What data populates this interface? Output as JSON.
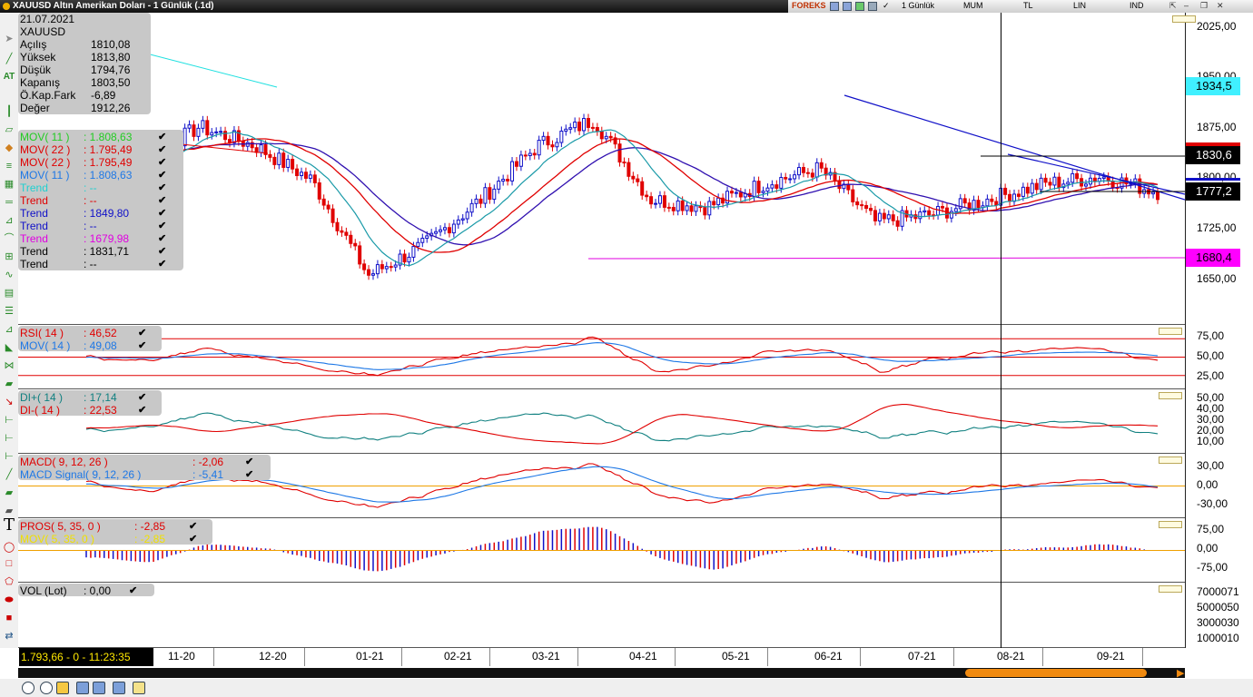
{
  "window": {
    "title": "XAUUSD Altın Amerikan Doları - 1 Günlük (.1d)",
    "brand": "FOREKS",
    "periods": [
      "1 Günlük",
      "MUM",
      "TL",
      "LIN",
      "IND"
    ]
  },
  "info": {
    "date": "21.07.2021",
    "symbol": "XAUUSD",
    "rows": [
      {
        "label": "Açılış",
        "value": "1810,08"
      },
      {
        "label": "Yüksek",
        "value": "1813,80"
      },
      {
        "label": "Düşük",
        "value": "1794,76"
      },
      {
        "label": "Kapanış",
        "value": "1803,50"
      },
      {
        "label": "Ö.Kap.Fark",
        "value": "-6,89"
      },
      {
        "label": "Değer",
        "value": "1912,26"
      }
    ]
  },
  "indicators": [
    {
      "name": "MOV( 11 )",
      "value": ": 1.808,63",
      "color": "#22cc22"
    },
    {
      "name": "MOV( 22 )",
      "value": ": 1.795,49",
      "color": "#e00000"
    },
    {
      "name": "MOV( 22 )",
      "value": ": 1.795,49",
      "color": "#e00000"
    },
    {
      "name": "MOV( 11 )",
      "value": ": 1.808,63",
      "color": "#1e78e6"
    },
    {
      "name": "Trend",
      "value": ": --",
      "color": "#20d0d0"
    },
    {
      "name": "Trend",
      "value": ": --",
      "color": "#e00000"
    },
    {
      "name": "Trend",
      "value": ": 1849,80",
      "color": "#1010c8"
    },
    {
      "name": "Trend",
      "value": ": --",
      "color": "#1010c8"
    },
    {
      "name": "Trend",
      "value": ": 1679,98",
      "color": "#e000e0"
    },
    {
      "name": "Trend",
      "value": ": 1831,71",
      "color": "#000000"
    },
    {
      "name": "Trend",
      "value": ": --",
      "color": "#000000"
    }
  ],
  "price_axis": {
    "ticks": [
      "2025,00",
      "1950,00",
      "1875,00",
      "1800,00",
      "1725,00",
      "1650,00"
    ],
    "tags": [
      {
        "text": "1934,5",
        "bg": "#40f0ff",
        "color": "#000"
      },
      {
        "text": "1830,6",
        "bg": "#000000",
        "color": "#fff"
      },
      {
        "text": "1777,2",
        "bg": "#000000",
        "color": "#fff"
      },
      {
        "text": "1680,4",
        "bg": "#ff00ff",
        "color": "#000"
      }
    ]
  },
  "rsi": {
    "labels": [
      {
        "name": "RSI( 14 )",
        "value": ": 46,52",
        "color": "#e00000"
      },
      {
        "name": "MOV( 14 )",
        "value": ": 49,08",
        "color": "#1e78e6"
      }
    ],
    "ticks": [
      "75,00",
      "50,00",
      "25,00"
    ]
  },
  "dmi": {
    "labels": [
      {
        "name": "DI+( 14 )",
        "value": ": 17,14",
        "color": "#108080"
      },
      {
        "name": "DI-( 14 )",
        "value": ": 22,53",
        "color": "#e00000"
      }
    ],
    "ticks": [
      "50,00",
      "40,00",
      "30,00",
      "20,00",
      "10,00"
    ]
  },
  "macd": {
    "labels": [
      {
        "name": "MACD( 9, 12, 26 )",
        "value": ": -2,06",
        "color": "#e00000"
      },
      {
        "name": "MACD Signal( 9, 12, 26 )",
        "value": ": -5,41",
        "color": "#1e78e6"
      }
    ],
    "ticks": [
      "30,00",
      "0,00",
      "-30,00"
    ]
  },
  "pros": {
    "labels": [
      {
        "name": "PROS( 5, 35, 0 )",
        "value": ": -2,85",
        "color": "#e00000"
      },
      {
        "name": "MOV( 5, 35, 0 )",
        "value": ": -2,85",
        "color": "#f0e000"
      }
    ],
    "ticks": [
      "75,00",
      "0,00",
      "-75,00"
    ]
  },
  "volume": {
    "labels": [
      {
        "name": "VOL (Lot)",
        "value": ": 0,00",
        "color": "#000000"
      }
    ],
    "ticks": [
      "7000071",
      "5000050",
      "3000030",
      "1000010"
    ]
  },
  "x_axis": [
    "11-20",
    "12-20",
    "01-21",
    "02-21",
    "03-21",
    "04-21",
    "05-21",
    "06-21",
    "07-21",
    "08-21",
    "09-21"
  ],
  "status": "1.793,66 - 0 - 11:23:35",
  "chart_data": [
    {
      "type": "candlestick",
      "title": "XAUUSD Altın Amerikan Doları - 1 Günlük (.1d)",
      "x": [
        "11-20",
        "12-20",
        "01-21",
        "02-21",
        "03-21",
        "04-21",
        "05-21",
        "06-21",
        "07-21",
        "08-21",
        "09-21"
      ],
      "series": [
        {
          "name": "XAUUSD",
          "close": [
            1870,
            1840,
            1885,
            1860,
            1815,
            1690,
            1730,
            1790,
            1860,
            1895,
            1790,
            1780,
            1810,
            1830,
            1760,
            1770,
            1790,
            1810,
            1820,
            1800
          ]
        },
        {
          "name": "MOV( 11 )",
          "values": [
            1860,
            1845,
            1875,
            1855,
            1810,
            1700,
            1725,
            1780,
            1855,
            1885,
            1800,
            1785,
            1805,
            1825,
            1770,
            1775,
            1790,
            1805,
            1815,
            1808.63
          ]
        },
        {
          "name": "MOV( 22 )",
          "values": [
            1850,
            1850,
            1870,
            1860,
            1820,
            1720,
            1720,
            1770,
            1840,
            1880,
            1810,
            1790,
            1800,
            1815,
            1785,
            1780,
            1790,
            1800,
            1810,
            1795.49
          ]
        }
      ],
      "ylim": [
        1625,
        2035
      ]
    },
    {
      "type": "line",
      "title": "RSI( 14 )",
      "series": [
        {
          "name": "RSI( 14 )",
          "values": [
            50,
            45,
            60,
            48,
            38,
            30,
            45,
            55,
            62,
            70,
            35,
            40,
            55,
            60,
            35,
            48,
            55,
            60,
            58,
            46.52
          ]
        },
        {
          "name": "MOV( 14 )",
          "values": [
            50,
            48,
            55,
            50,
            42,
            35,
            42,
            52,
            60,
            68,
            45,
            42,
            50,
            56,
            45,
            47,
            52,
            56,
            55,
            49.08
          ]
        }
      ],
      "ylim": [
        15,
        85
      ]
    },
    {
      "type": "line",
      "title": "DMI",
      "series": [
        {
          "name": "DI+( 14 )",
          "values": [
            20,
            22,
            35,
            25,
            15,
            12,
            20,
            28,
            35,
            30,
            12,
            15,
            22,
            25,
            15,
            18,
            22,
            28,
            25,
            17.14
          ]
        },
        {
          "name": "DI-( 14 )",
          "values": [
            22,
            25,
            18,
            25,
            32,
            35,
            25,
            15,
            10,
            8,
            35,
            30,
            22,
            18,
            45,
            35,
            28,
            22,
            25,
            22.53
          ]
        }
      ],
      "ylim": [
        0,
        55
      ]
    },
    {
      "type": "line",
      "title": "MACD( 9, 12, 26 )",
      "series": [
        {
          "name": "MACD( 9, 12, 26 )",
          "values": [
            5,
            -10,
            15,
            5,
            -15,
            -30,
            -10,
            10,
            25,
            28,
            -10,
            -25,
            -5,
            5,
            -15,
            -10,
            0,
            5,
            8,
            -2.06
          ]
        },
        {
          "name": "MACD Signal( 9, 12, 26 )",
          "values": [
            3,
            -5,
            10,
            8,
            -10,
            -25,
            -15,
            5,
            20,
            30,
            0,
            -20,
            -10,
            0,
            -10,
            -12,
            -3,
            2,
            5,
            -5.41
          ]
        }
      ],
      "ylim": [
        -45,
        45
      ]
    },
    {
      "type": "bar",
      "title": "PROS( 5, 35, 0 )",
      "series": [
        {
          "name": "PROS( 5, 35, 0 )",
          "values": [
            -20,
            -40,
            20,
            10,
            -30,
            -70,
            -20,
            20,
            60,
            75,
            -20,
            -60,
            -10,
            15,
            -40,
            -20,
            0,
            10,
            20,
            -2.85
          ]
        }
      ],
      "ylim": [
        -100,
        100
      ]
    },
    {
      "type": "bar",
      "title": "VOL (Lot)",
      "series": [
        {
          "name": "VOL (Lot)",
          "values": [
            0
          ]
        }
      ]
    }
  ]
}
